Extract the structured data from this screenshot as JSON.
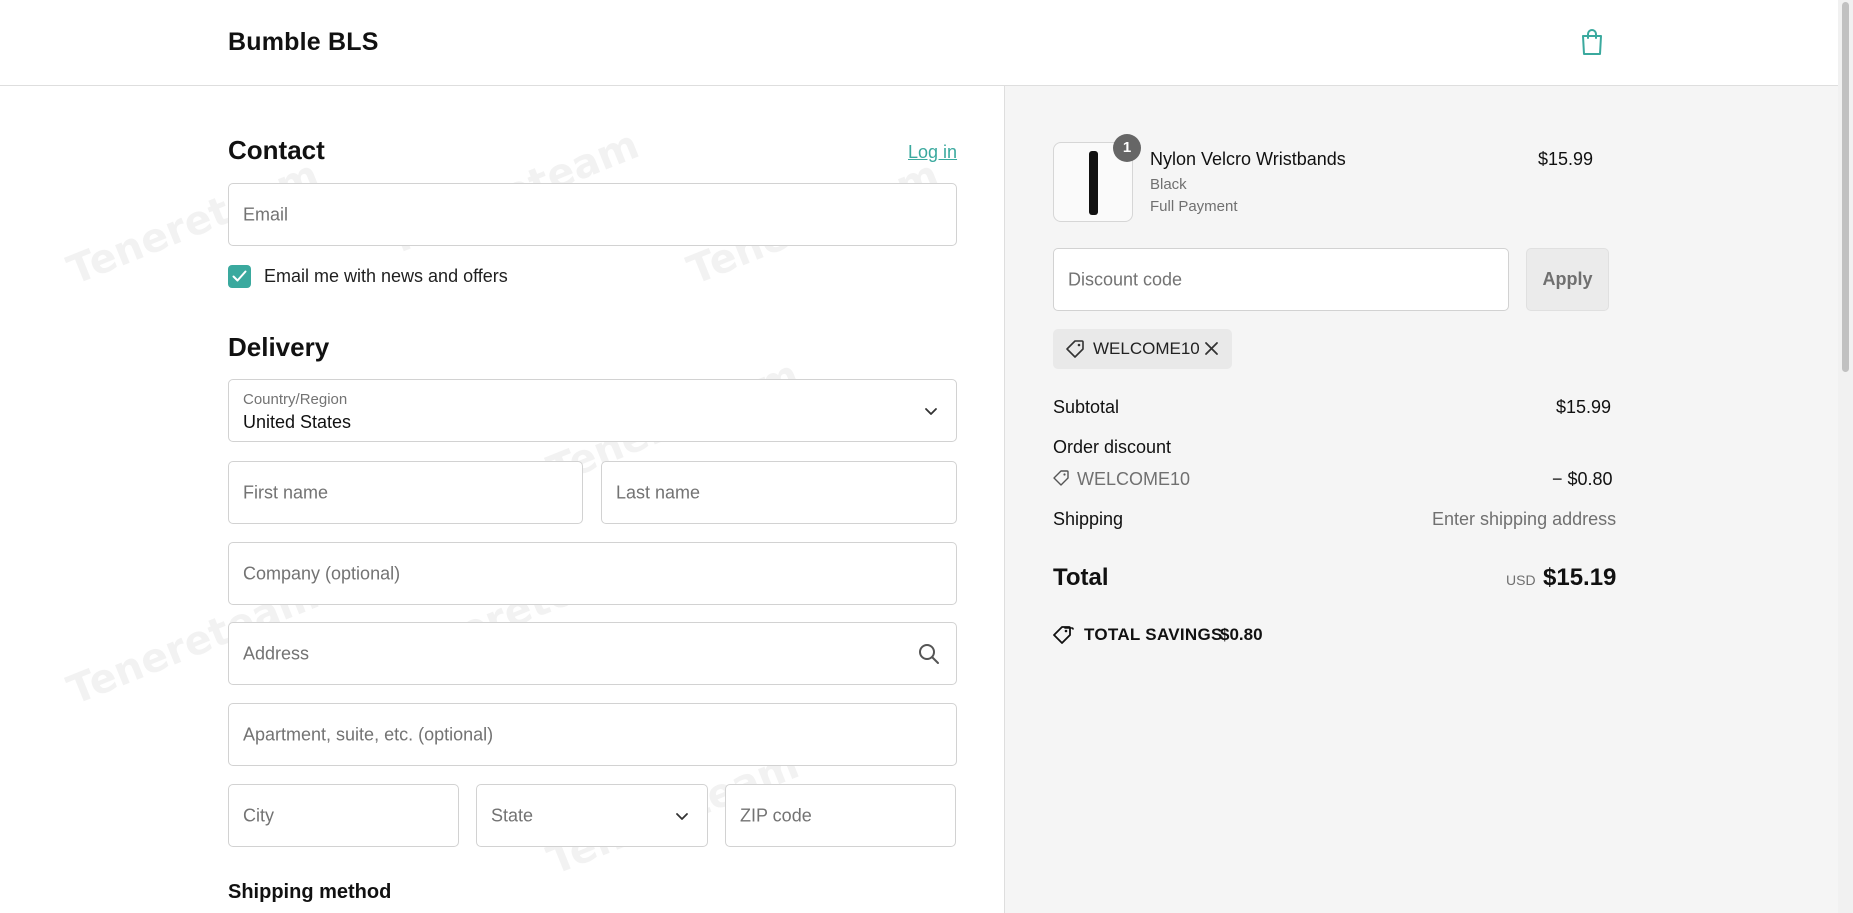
{
  "header": {
    "brand": "Bumble BLS",
    "cart_icon": "shopping-bag-icon"
  },
  "contact": {
    "title": "Contact",
    "login_link": "Log in",
    "email_placeholder": "Email",
    "newsletter_label": "Email me with news and offers",
    "newsletter_checked": true
  },
  "delivery": {
    "title": "Delivery",
    "country_label": "Country/Region",
    "country_value": "United States",
    "first_name_placeholder": "First name",
    "last_name_placeholder": "Last name",
    "company_placeholder": "Company (optional)",
    "address_placeholder": "Address",
    "apartment_placeholder": "Apartment, suite, etc. (optional)",
    "city_placeholder": "City",
    "state_placeholder": "State",
    "zip_placeholder": "ZIP code"
  },
  "shipping_method": {
    "title": "Shipping method"
  },
  "order_summary": {
    "item": {
      "quantity": "1",
      "name": "Nylon Velcro Wristbands",
      "variant": "Black",
      "plan": "Full Payment",
      "price": "$15.99"
    },
    "discount_placeholder": "Discount code",
    "apply_label": "Apply",
    "applied_code": "WELCOME10",
    "subtotal_label": "Subtotal",
    "subtotal_value": "$15.99",
    "order_discount_label": "Order discount",
    "discount_code": "WELCOME10",
    "discount_value": "− $0.80",
    "shipping_label": "Shipping",
    "shipping_value": "Enter shipping address",
    "total_label": "Total",
    "currency": "USD",
    "total_value": "$15.19",
    "savings_label": "TOTAL SAVINGS",
    "savings_value": "$0.80"
  },
  "watermark": "Tenereteam",
  "colors": {
    "accent": "#3aa99e",
    "summary_bg": "#f5f5f5",
    "border": "#d2d2d2"
  }
}
